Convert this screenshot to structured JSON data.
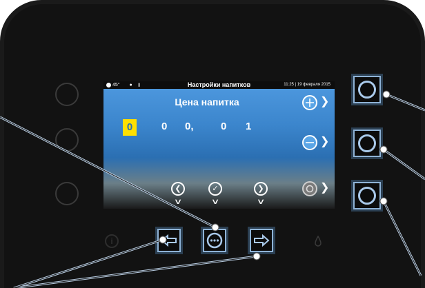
{
  "screen": {
    "status_left": "45°",
    "title": "Настройки напитков",
    "status_right": "11:25 | 19 февраля 2015"
  },
  "price_title": "Цена напитка",
  "digits": [
    "0",
    "0",
    "0,",
    "0",
    "1"
  ],
  "side_icons": [
    "plus-icon",
    "minus-icon",
    "refresh-icon"
  ],
  "bottom_icons": [
    "chevron-left-icon",
    "check-icon",
    "chevron-right-icon"
  ],
  "colors": {
    "accent": "#ffe000",
    "screen_blue": "#3b85cc",
    "button_outline": "#8fb3d6"
  }
}
